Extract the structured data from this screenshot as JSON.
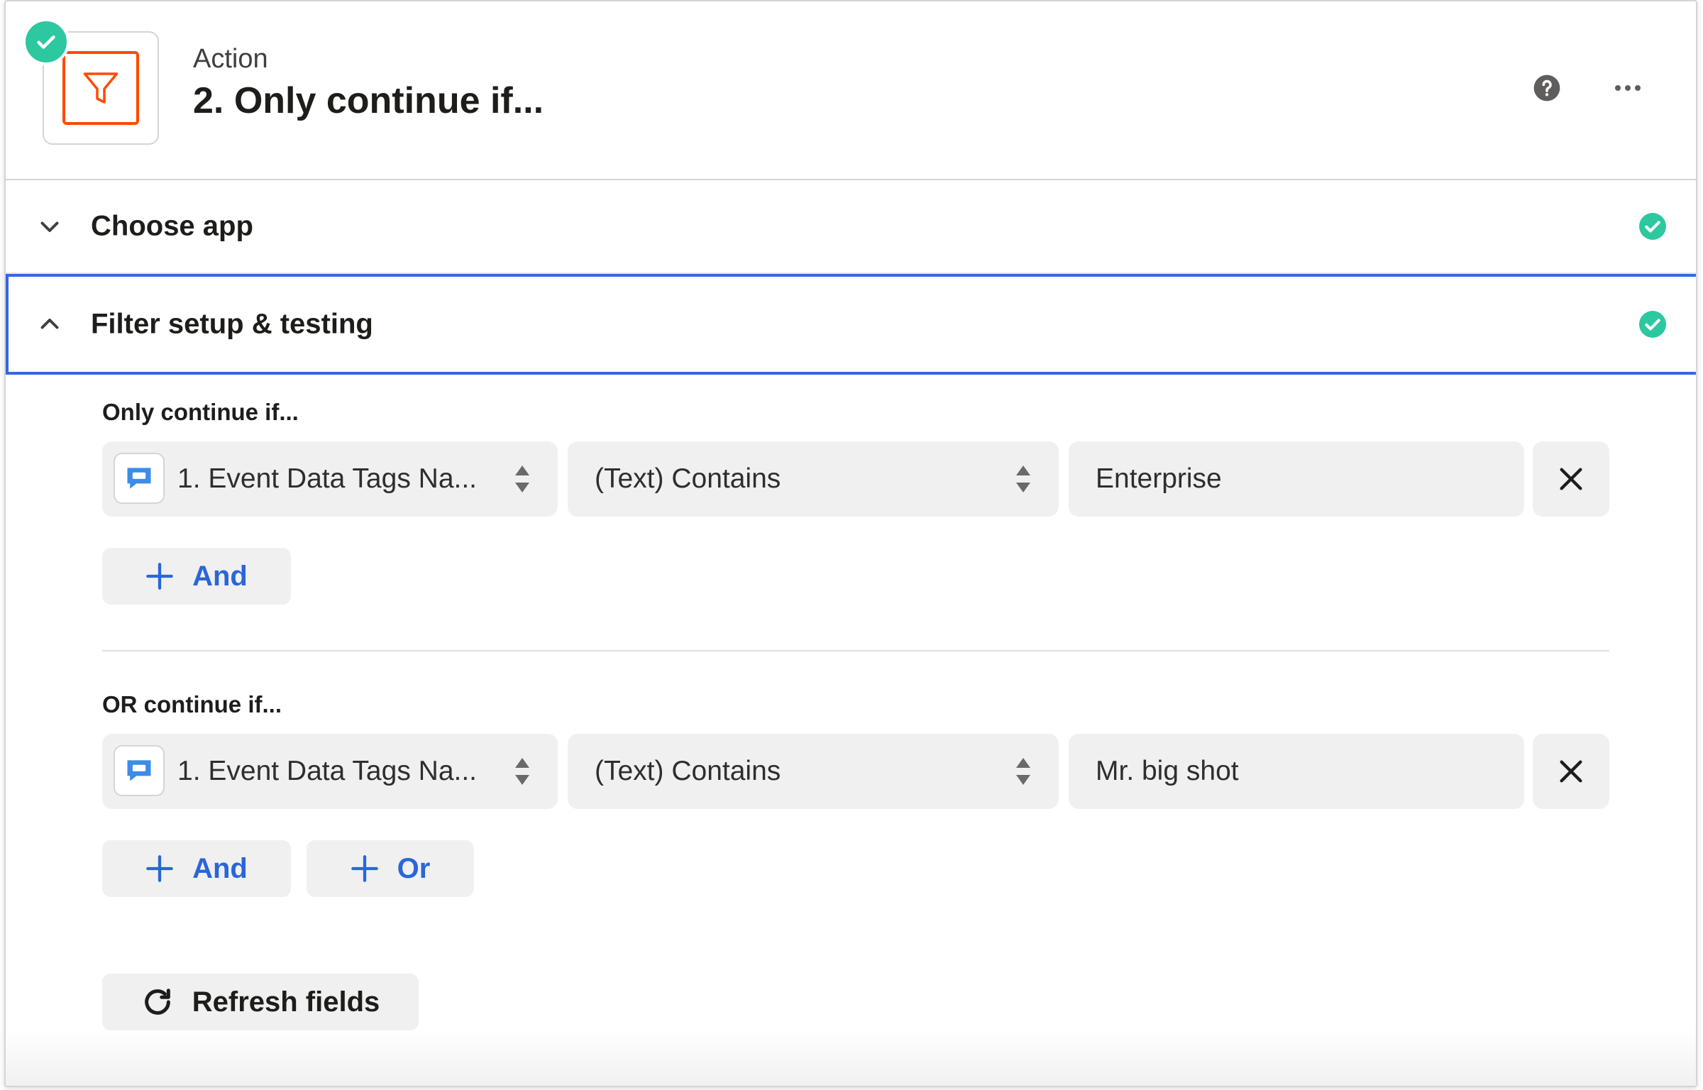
{
  "header": {
    "step_kind": "Action",
    "step_title": "2. Only continue if...",
    "icons": {
      "app": "filter-icon",
      "status": "check-circle-icon",
      "help": "help-circle-icon",
      "more": "more-horizontal-icon"
    }
  },
  "sections": {
    "choose_app": {
      "label": "Choose app",
      "state": "collapsed",
      "status": "complete"
    },
    "filter_setup": {
      "label": "Filter setup & testing",
      "state": "expanded",
      "status": "complete"
    }
  },
  "filter": {
    "groups": [
      {
        "label": "Only continue if...",
        "conditions": [
          {
            "source": "1. Event Data Tags Na...",
            "operator": "(Text) Contains",
            "value": "Enterprise"
          }
        ],
        "buttons": {
          "and": "And"
        }
      },
      {
        "label": "OR continue if...",
        "conditions": [
          {
            "source": "1. Event Data Tags Na...",
            "operator": "(Text) Contains",
            "value": "Mr. big shot"
          }
        ],
        "buttons": {
          "and": "And",
          "or": "Or"
        }
      }
    ],
    "refresh_label": "Refresh fields"
  },
  "colors": {
    "accent_blue": "#3466e6",
    "link_blue": "#2a66d9",
    "success_green": "#2dc7a0",
    "brand_orange": "#ff4a00",
    "field_bg": "#f0f0f0"
  }
}
